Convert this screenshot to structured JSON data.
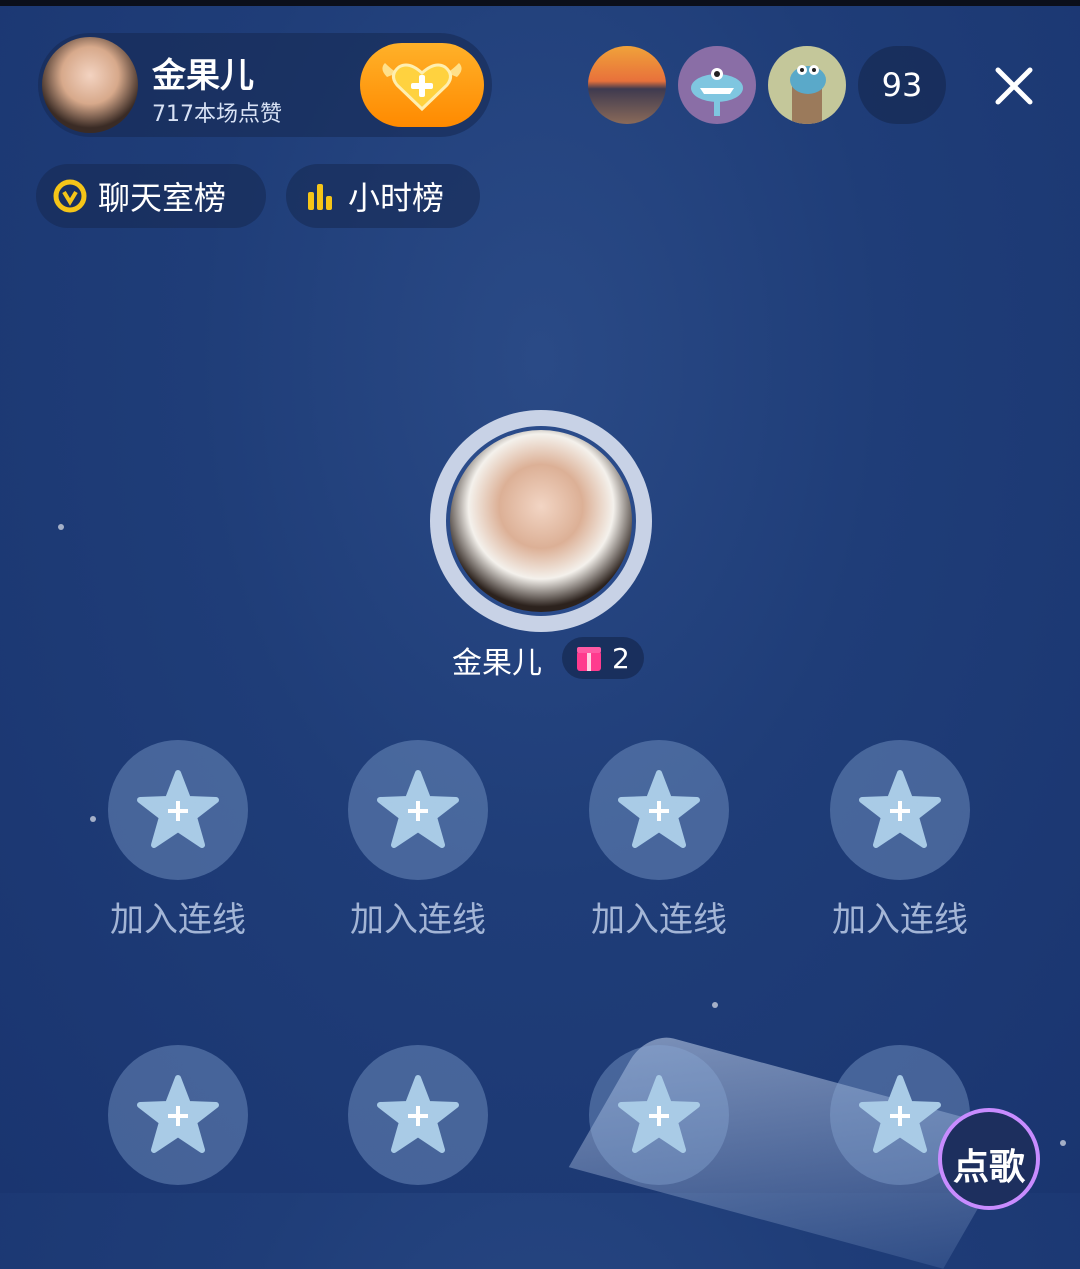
{
  "host": {
    "name": "金果儿",
    "likes": "717本场点赞"
  },
  "viewers": {
    "count": "93"
  },
  "ranks": {
    "chat_room": "聊天室榜",
    "hourly": "小时榜"
  },
  "main_seat": {
    "name": "金果儿",
    "gifts": "2"
  },
  "seats": {
    "row1": [
      "加入连线",
      "加入连线",
      "加入连线",
      "加入连线"
    ]
  },
  "song_button": "点歌",
  "colors": {
    "background": "#1f3d78",
    "follow_orange": "#ff9500",
    "rank_icon_yellow": "#f5c518",
    "gift_pink": "#ff3b8e"
  }
}
